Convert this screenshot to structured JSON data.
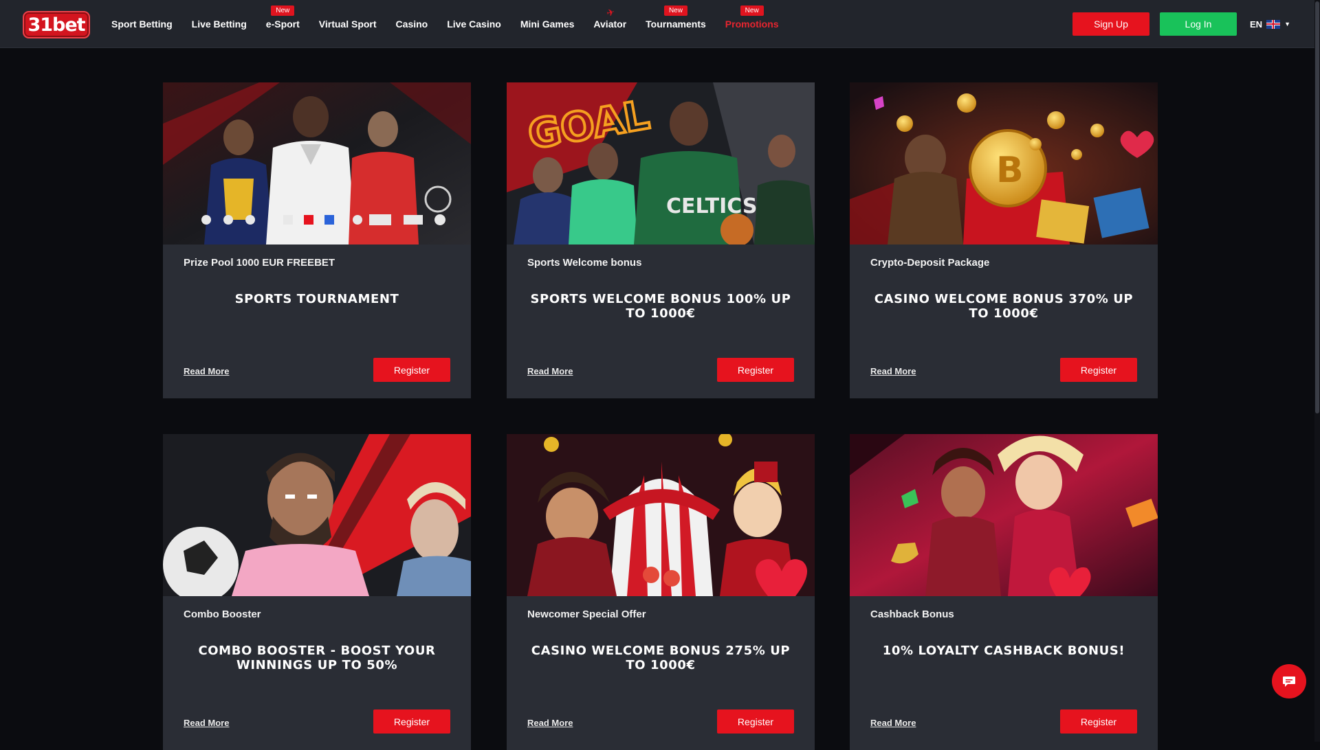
{
  "header": {
    "logo_text": "31bet",
    "nav": [
      {
        "label": "Sport Betting"
      },
      {
        "label": "Live Betting"
      },
      {
        "label": "e-Sport",
        "badge": "New"
      },
      {
        "label": "Virtual Sport"
      },
      {
        "label": "Casino"
      },
      {
        "label": "Live Casino"
      },
      {
        "label": "Mini Games"
      },
      {
        "label": "Aviator",
        "icon": "plane-icon"
      },
      {
        "label": "Tournaments",
        "badge": "New"
      },
      {
        "label": "Promotions",
        "badge": "New",
        "active": true
      }
    ],
    "signup_label": "Sign Up",
    "login_label": "Log In",
    "language": "EN",
    "language_icon": "uk-flag-icon"
  },
  "colors": {
    "accent_red": "#e6131e",
    "login_green": "#19c25a",
    "header_bg": "#22252c",
    "card_bg": "#2a2d35",
    "page_bg": "#0b0c10"
  },
  "promotions": [
    {
      "subtitle": "Prize Pool 1000 EUR FREEBET",
      "title": "SPORTS TOURNAMENT",
      "read_more": "Read More",
      "register": "Register",
      "image": "sports-stars-banner"
    },
    {
      "subtitle": "Sports Welcome bonus",
      "title": "SPORTS WELCOME BONUS 100% UP TO 1000€",
      "read_more": "Read More",
      "register": "Register",
      "image": "goal-basketball-banner"
    },
    {
      "subtitle": "Crypto-Deposit Package",
      "title": "CASINO WELCOME BONUS 370% UP TO 1000€",
      "read_more": "Read More",
      "register": "Register",
      "image": "bitcoin-treasure-banner"
    },
    {
      "subtitle": "Combo Booster",
      "title": "COMBO BOOSTER - BOOST YOUR WINNINGS UP TO 50%",
      "read_more": "Read More",
      "register": "Register",
      "image": "football-players-banner"
    },
    {
      "subtitle": "Newcomer Special Offer",
      "title": "CASINO WELCOME BONUS 275% UP TO 1000€",
      "read_more": "Read More",
      "register": "Register",
      "image": "circus-pirate-banner"
    },
    {
      "subtitle": "Cashback Bonus",
      "title": "10% LOYALTY CASHBACK BONUS!",
      "read_more": "Read More",
      "register": "Register",
      "image": "genie-heroine-banner"
    }
  ],
  "chat_icon": "chat-icon"
}
